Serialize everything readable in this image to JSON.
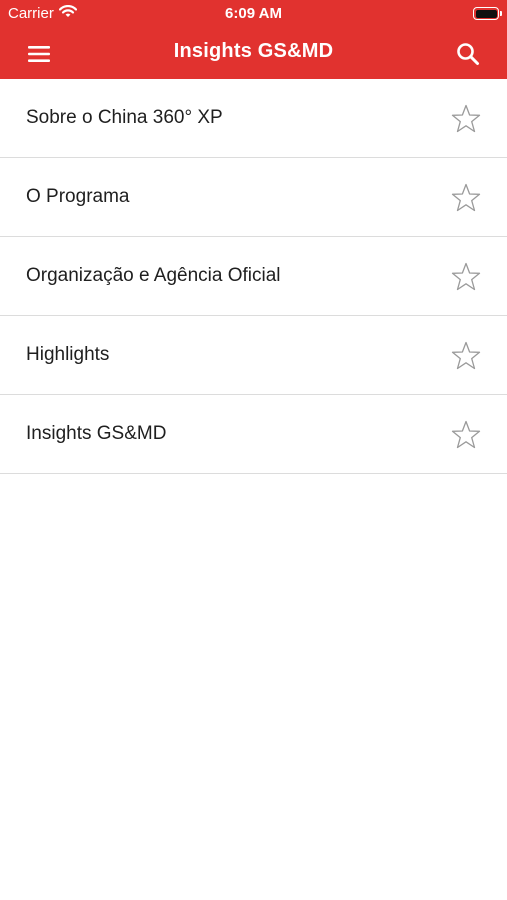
{
  "colors": {
    "brand": "#e1322f",
    "text": "#1f1f1f",
    "divider": "#dcdcdc",
    "star_outline": "#9a9a9a"
  },
  "status_bar": {
    "carrier": "Carrier",
    "time": "6:09 AM",
    "wifi_icon": "wifi-icon",
    "battery_icon": "battery-icon"
  },
  "nav_bar": {
    "title": "Insights GS&MD",
    "menu_icon": "hamburger-menu-icon",
    "search_icon": "search-icon"
  },
  "list": {
    "items": [
      {
        "label": "Sobre o China 360° XP",
        "favorite": false,
        "icon": "star-outline-icon"
      },
      {
        "label": "O Programa",
        "favorite": false,
        "icon": "star-outline-icon"
      },
      {
        "label": "Organização e Agência Oficial",
        "favorite": false,
        "icon": "star-outline-icon"
      },
      {
        "label": "Highlights",
        "favorite": false,
        "icon": "star-outline-icon"
      },
      {
        "label": "Insights GS&MD",
        "favorite": false,
        "icon": "star-outline-icon"
      }
    ]
  }
}
